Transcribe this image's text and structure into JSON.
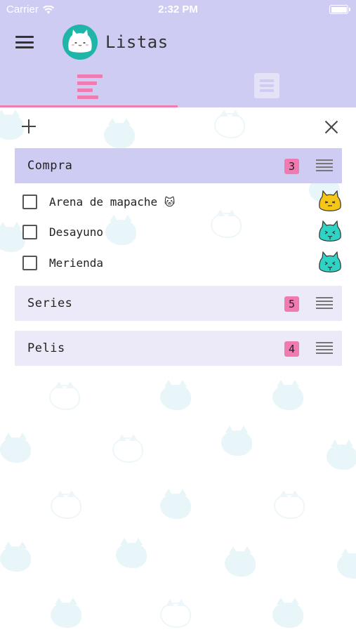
{
  "status_bar": {
    "carrier": "Carrier",
    "time": "2:32 PM"
  },
  "header": {
    "title": "Listas"
  },
  "tabs": [
    {
      "name": "lists",
      "active": true
    },
    {
      "name": "notes",
      "active": false
    }
  ],
  "colors": {
    "header_bg": "#cfccf4",
    "accent_pink": "#f07bb0",
    "list_header_inactive": "#eceaf8",
    "cat_yellow": "#f5c518",
    "cat_teal": "#2fd3c4"
  },
  "lists": [
    {
      "title": "Compra",
      "count": "3",
      "expanded": true,
      "items": [
        {
          "label": "Arena de mapache",
          "emoji": "🐱",
          "checked": false,
          "avatar": "yellow-cat-icon"
        },
        {
          "label": "Desayuno",
          "emoji": "",
          "checked": false,
          "avatar": "teal-cat-icon"
        },
        {
          "label": "Merienda",
          "emoji": "",
          "checked": false,
          "avatar": "teal-cat-icon"
        }
      ]
    },
    {
      "title": "Series",
      "count": "5",
      "expanded": false
    },
    {
      "title": "Pelis",
      "count": "4",
      "expanded": false
    }
  ]
}
